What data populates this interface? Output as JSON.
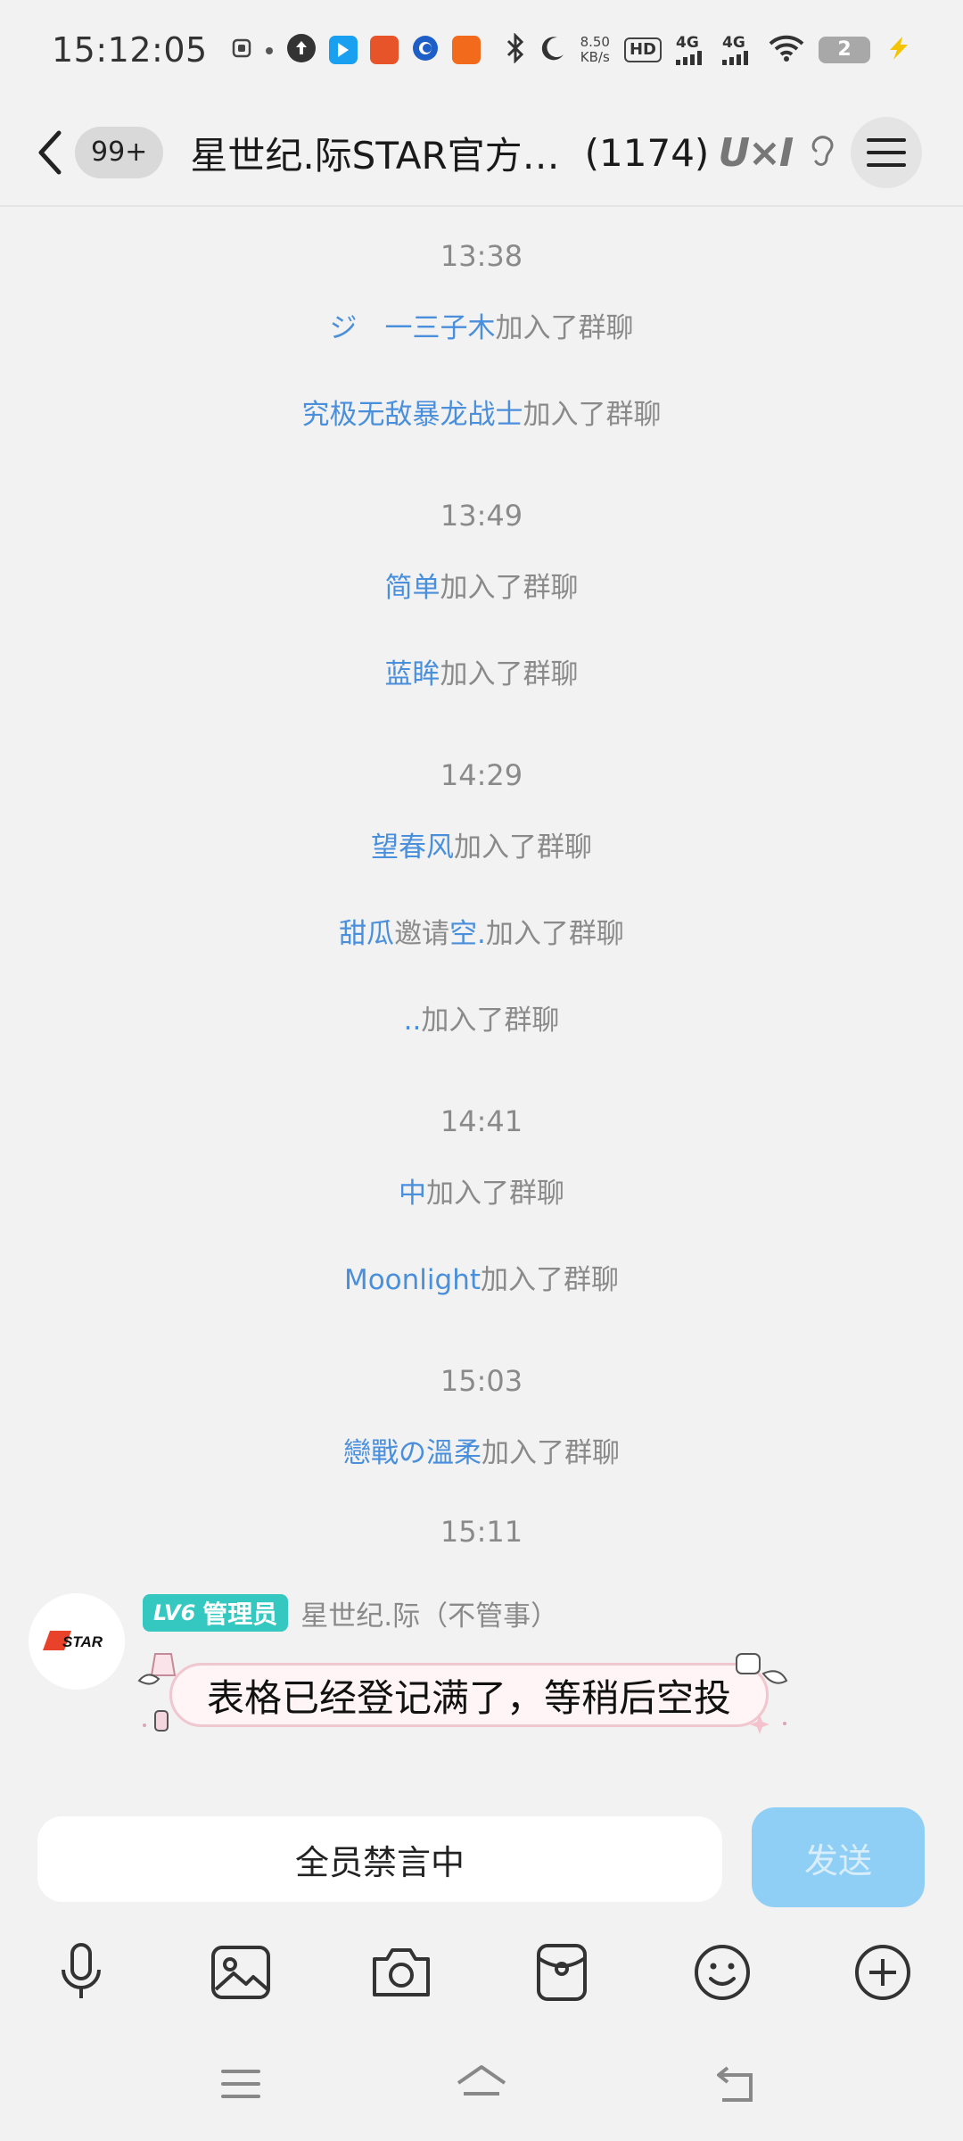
{
  "status_bar": {
    "time": "15:12:05",
    "net_speed_value": "8.50",
    "net_speed_unit": "KB/s",
    "hd_label": "HD",
    "sim1": "4G",
    "sim2": "4G",
    "battery_level": "2"
  },
  "header": {
    "unread_badge": "99+",
    "group_title": "星世纪.际STAR官方…",
    "member_count": "(1174)",
    "title_logo": "U×I"
  },
  "messages": [
    {
      "type": "time",
      "text": "13:38"
    },
    {
      "type": "system",
      "name": "ジ　一三子木",
      "suffix": "加入了群聊"
    },
    {
      "type": "system",
      "name": "究极无敌暴龙战士",
      "suffix": "加入了群聊"
    },
    {
      "type": "time",
      "text": "13:49"
    },
    {
      "type": "system",
      "name": "简单",
      "suffix": "加入了群聊"
    },
    {
      "type": "system",
      "name": "蓝眸",
      "suffix": "加入了群聊"
    },
    {
      "type": "time",
      "text": "14:29"
    },
    {
      "type": "system",
      "name": "望春风",
      "suffix": "加入了群聊"
    },
    {
      "type": "system_invite",
      "name": "甜瓜",
      "verb": "邀请",
      "invitee": "空.",
      "suffix": "加入了群聊"
    },
    {
      "type": "system",
      "name": "..",
      "suffix": "加入了群聊"
    },
    {
      "type": "time",
      "text": "14:41"
    },
    {
      "type": "system",
      "name": "中",
      "suffix": "加入了群聊"
    },
    {
      "type": "system",
      "name": "Moonlight",
      "suffix": "加入了群聊"
    },
    {
      "type": "time",
      "text": "15:03"
    },
    {
      "type": "system",
      "name": "戀戰の溫柔",
      "suffix": "加入了群聊"
    },
    {
      "type": "time",
      "text": "15:11"
    }
  ],
  "chat_message": {
    "level": "LV6",
    "role": "管理员",
    "sender": "星世纪.际（不管事）",
    "avatar_text": "STAR",
    "text": "表格已经登记满了，等稍后空投"
  },
  "input": {
    "muted_text": "全员禁言中",
    "send_label": "发送"
  },
  "toolbar": {
    "icons": [
      "microphone-icon",
      "image-icon",
      "camera-icon",
      "red-packet-icon",
      "emoji-icon",
      "plus-icon"
    ]
  },
  "nav": {
    "icons": [
      "menu-icon",
      "home-icon",
      "back-icon"
    ]
  },
  "colors": {
    "name_link": "#4a8fdc",
    "system_text": "#8a8a8a",
    "badge_teal": "#34c8c0",
    "send_button": "#8fcff6",
    "bubble_border": "#f0c6cf"
  }
}
